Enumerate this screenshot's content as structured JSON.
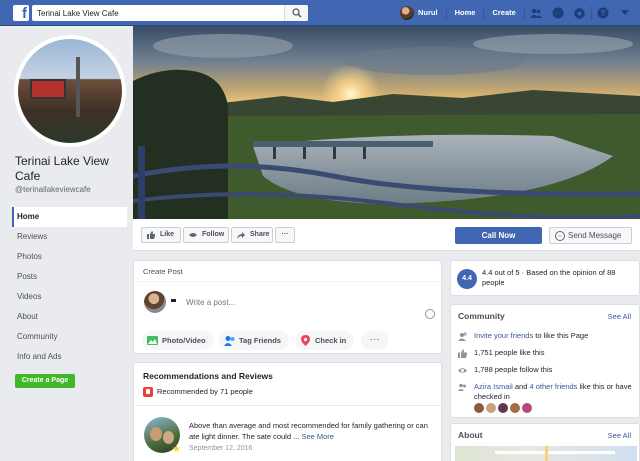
{
  "topbar": {
    "logo": "f",
    "search_value": "Terinai Lake View Cafe",
    "user_name": "Nurul",
    "home_label": "Home",
    "create_label": "Create"
  },
  "sidebar": {
    "page_name": "Terinai Lake View Cafe",
    "handle": "@terinailakeviewcafe",
    "items": [
      {
        "label": "Home"
      },
      {
        "label": "Reviews"
      },
      {
        "label": "Photos"
      },
      {
        "label": "Posts"
      },
      {
        "label": "Videos"
      },
      {
        "label": "About"
      },
      {
        "label": "Community"
      },
      {
        "label": "Info and Ads"
      }
    ],
    "create_page_label": "Create a Page"
  },
  "actions": {
    "like": "Like",
    "follow": "Follow",
    "share": "Share",
    "more": "···",
    "call_now": "Call Now",
    "send_message": "Send Message"
  },
  "create_post": {
    "title": "Create Post",
    "placeholder": "Write a post...",
    "photo_video": "Photo/Video",
    "tag_friends": "Tag Friends",
    "check_in": "Check in",
    "more": "···"
  },
  "reviews": {
    "title": "Recommendations and Reviews",
    "recommended": "Recommended by 71 people",
    "review_text": "Above than average and most recommended for family gathering or can ate light dinner. The sate could ...",
    "see_more": "See More",
    "date": "September 12, 2016"
  },
  "rating": {
    "score": "4.4",
    "text": "4.4 out of 5 · Based on the opinion of 88 people"
  },
  "community": {
    "title": "Community",
    "see_all": "See All",
    "invite_link": "Invite your friends",
    "invite_rest": "to like this Page",
    "likes": "1,751 people like this",
    "follows": "1,788 people follow this",
    "friends_name": "Azira Ismail",
    "friends_and": "and",
    "friends_other": "4 other friends",
    "friends_rest": "like this or have checked in"
  },
  "about": {
    "title": "About",
    "see_all": "See All"
  },
  "colors": {
    "topbar": "#4267b2",
    "call_now": "#4267b2",
    "create_page": "#42b72a",
    "link": "#385898"
  }
}
